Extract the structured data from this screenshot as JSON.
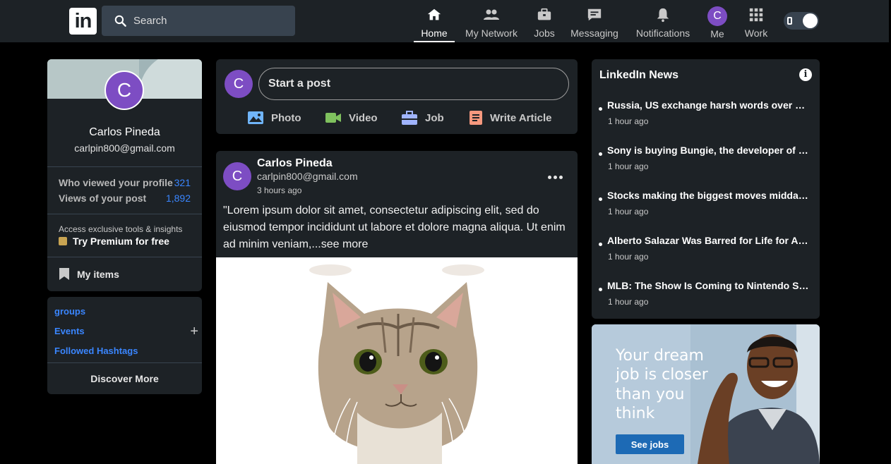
{
  "header": {
    "logo_text": "in",
    "search_placeholder": "Search",
    "nav": [
      {
        "label": "Home",
        "icon": "home-icon"
      },
      {
        "label": "My Network",
        "icon": "people-icon"
      },
      {
        "label": "Jobs",
        "icon": "briefcase-icon"
      },
      {
        "label": "Messaging",
        "icon": "message-icon"
      },
      {
        "label": "Notifications",
        "icon": "bell-icon"
      },
      {
        "label": "Me",
        "icon": "avatar",
        "initial": "C"
      },
      {
        "label": "Work",
        "icon": "grid-icon"
      }
    ],
    "active_nav": "Home"
  },
  "profile": {
    "initial": "C",
    "name": "Carlos Pineda",
    "email": "carlpin800@gmail.com",
    "stats": [
      {
        "label": "Who viewed your profile",
        "value": "321"
      },
      {
        "label": "Views of your post",
        "value": "1,892"
      }
    ],
    "premium_text": "Access exclusive tools & insights",
    "premium_link": "Try Premium for free",
    "my_items": "My items"
  },
  "groups": {
    "links": [
      "groups",
      "Events",
      "Followed Hashtags"
    ],
    "plus": "+",
    "discover": "Discover More"
  },
  "share": {
    "initial": "C",
    "placeholder": "Start a post",
    "buttons": [
      {
        "label": "Photo",
        "icon": "photo-icon",
        "color": "#70b5f9"
      },
      {
        "label": "Video",
        "icon": "video-icon",
        "color": "#7fc15e"
      },
      {
        "label": "Job",
        "icon": "job-icon",
        "color": "#a0b4ff"
      },
      {
        "label": "Write Article",
        "icon": "article-icon",
        "color": "#f5987e"
      }
    ]
  },
  "post": {
    "initial": "C",
    "name": "Carlos Pineda",
    "email": "carlpin800@gmail.com",
    "time": "3 hours ago",
    "text": "\"Lorem ipsum dolor sit amet, consectetur adipiscing elit, sed do eiusmod tempor incididunt ut labore et dolore magna aliqua. Ut enim ad minim veniam,...see more",
    "image": "cat-photo"
  },
  "news": {
    "title": "LinkedIn News",
    "items": [
      {
        "headline": "Russia, US exchange harsh words over Ukraine",
        "time": "1 hour ago"
      },
      {
        "headline": "Sony is buying Bungie, the developer of Destiny",
        "time": "1 hour ago"
      },
      {
        "headline": "Stocks making the biggest moves midday: Tesla",
        "time": "1 hour ago"
      },
      {
        "headline": "Alberto Salazar Was Barred for Life for Abuse",
        "time": "1 hour ago"
      },
      {
        "headline": "MLB: The Show Is Coming to Nintendo Switch",
        "time": "1 hour ago"
      }
    ]
  },
  "ad": {
    "lines": [
      "Your dream",
      "job is closer",
      "than you",
      "think"
    ],
    "button": "See jobs"
  },
  "colors": {
    "accent": "#3a86ff",
    "avatar": "#7d4dc3",
    "card": "#1d2226"
  }
}
